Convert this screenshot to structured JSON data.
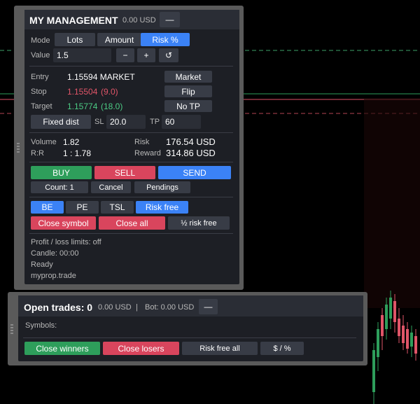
{
  "management": {
    "title": "MY MANAGEMENT",
    "balance": "0.00 USD",
    "collapse_label": "—",
    "mode_label": "Mode",
    "modes": [
      "Lots",
      "Amount",
      "Risk %"
    ],
    "value_label": "Value",
    "value": "1.5",
    "minus_label": "−",
    "plus_label": "+",
    "reset_glyph": "↺",
    "entry_label": "Entry",
    "entry_value": "1.15594 MARKET",
    "market_label": "Market",
    "stop_label": "Stop",
    "stop_value": "1.15504",
    "stop_pips": "(9.0)",
    "flip_label": "Flip",
    "target_label": "Target",
    "target_value": "1.15774",
    "target_pips": "(18.0)",
    "notp_label": "No TP",
    "fixed_dist_label": "Fixed dist",
    "sl_label": "SL",
    "sl_value": "20.0",
    "tp_label": "TP",
    "tp_value": "60",
    "volume_label": "Volume",
    "volume_value": "1.82",
    "risk_label": "Risk",
    "risk_value": "176.54 USD",
    "rr_label": "R:R",
    "rr_value": "1 : 1.78",
    "reward_label": "Reward",
    "reward_value": "314.86 USD",
    "buy_label": "BUY",
    "sell_label": "SELL",
    "send_label": "SEND",
    "count_label": "Count: 1",
    "cancel_label": "Cancel",
    "pendings_label": "Pendings",
    "be_label": "BE",
    "pe_label": "PE",
    "tsl_label": "TSL",
    "riskfree_label": "Risk free",
    "close_symbol_label": "Close symbol",
    "close_all_label": "Close all",
    "half_riskfree_label": "½ risk free",
    "status_limits": "Profit / loss limits: off",
    "status_candle": "Candle: 00:00",
    "status_ready": "Ready",
    "status_site": "myprop.trade"
  },
  "trades": {
    "title": "Open trades: 0",
    "amount": "0.00 USD",
    "divider": "|",
    "bot": "Bot: 0.00 USD",
    "collapse_label": "—",
    "symbols_label": "Symbols:",
    "close_winners_label": "Close winners",
    "close_losers_label": "Close losers",
    "riskfree_all_label": "Risk free all",
    "dollar_pct_label": "$ / %"
  },
  "colors": {
    "accent_blue": "#3b82f6",
    "buy_green": "#2e9e5b",
    "sell_red": "#d9455d",
    "panel_bg": "#1d1f25"
  }
}
